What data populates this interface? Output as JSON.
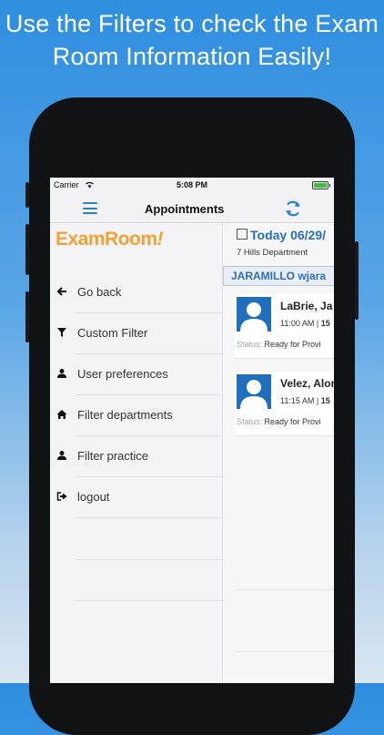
{
  "headline": {
    "line1": "Use the Filters to check the Exam",
    "line2": "Room Information Easily!"
  },
  "status_bar": {
    "carrier": "Carrier",
    "time": "5:08 PM"
  },
  "nav": {
    "title": "Appointments",
    "menu_icon": "hamburger-icon",
    "refresh_icon": "refresh-icon"
  },
  "sidebar": {
    "logo_exam": "Exam",
    "logo_room": "Room",
    "logo_bang": "!",
    "items": [
      {
        "label": "Go back",
        "icon": "arrow-left-icon"
      },
      {
        "label": "Custom Filter",
        "icon": "filter-icon"
      },
      {
        "label": "User preferences",
        "icon": "user-icon"
      },
      {
        "label": "Filter departments",
        "icon": "home-icon"
      },
      {
        "label": "Filter practice",
        "icon": "user-icon"
      },
      {
        "label": "logout",
        "icon": "logout-icon"
      }
    ]
  },
  "content": {
    "today": "Today 06/29/",
    "department": "7 Hills Department",
    "doctor": "JARAMILLO wjara",
    "appointments": [
      {
        "name": "LaBrie, Ja",
        "time": "11:00 AM",
        "duration": "15",
        "status_label": "Status:",
        "status": "Ready for Provi"
      },
      {
        "name": "Velez, Alon",
        "time": "11:15 AM",
        "duration": "15",
        "status_label": "Status:",
        "status": "Ready for Provi"
      }
    ]
  },
  "colors": {
    "accent": "#2a7fd6",
    "logo": "#f2a135",
    "avatar": "#1f6fbe"
  }
}
